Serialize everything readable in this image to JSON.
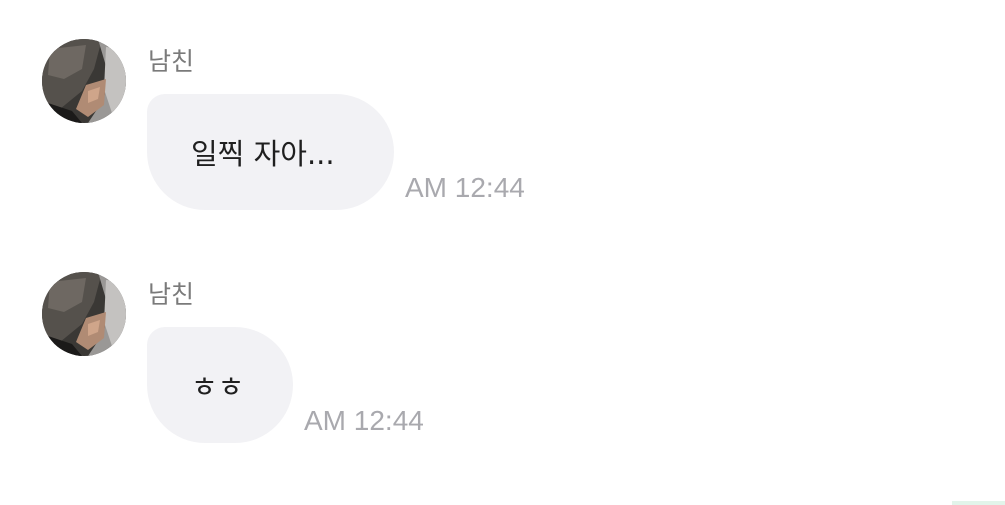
{
  "messages": [
    {
      "sender": "남친",
      "text": "일찍 자아...",
      "time": "AM 12:44",
      "avatar_icon": "profile-photo"
    },
    {
      "sender": "남친",
      "text": "ㅎㅎ",
      "time": "AM 12:44",
      "avatar_icon": "profile-photo"
    }
  ],
  "colors": {
    "background": "#ffffff",
    "bubble": "#f2f2f5",
    "sender_text": "#7a7a7a",
    "message_text": "#1f1f1f",
    "time_text": "#a9a9ae"
  }
}
